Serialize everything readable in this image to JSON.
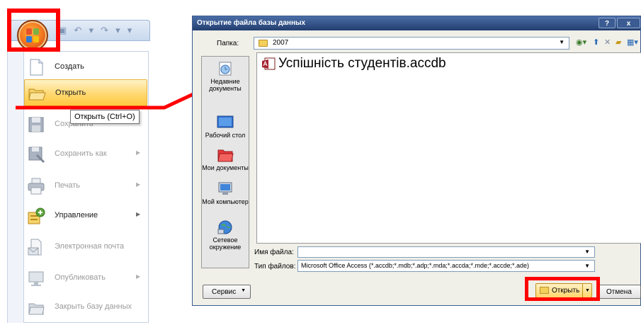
{
  "office_menu": {
    "items": [
      {
        "label": "Создать",
        "icon": "new-document-icon",
        "enabled": true,
        "submenu": false
      },
      {
        "label": "Открыть",
        "icon": "open-folder-icon",
        "enabled": true,
        "submenu": false
      },
      {
        "label": "Сохранить",
        "icon": "save-disk-icon",
        "enabled": false,
        "submenu": false
      },
      {
        "label": "Сохранить как",
        "icon": "save-as-icon",
        "enabled": false,
        "submenu": true
      },
      {
        "label": "Печать",
        "icon": "printer-icon",
        "enabled": false,
        "submenu": true
      },
      {
        "label": "Управление",
        "icon": "manage-icon",
        "enabled": true,
        "submenu": true
      },
      {
        "label": "Электронная почта",
        "icon": "email-icon",
        "enabled": false,
        "submenu": false
      },
      {
        "label": "Опубликовать",
        "icon": "publish-icon",
        "enabled": false,
        "submenu": true
      },
      {
        "label": "Закрыть базу данных",
        "icon": "close-database-icon",
        "enabled": false,
        "submenu": false
      }
    ],
    "tooltip": "Открыть (Ctrl+O)"
  },
  "dialog": {
    "title": "Открытие файла базы данных",
    "help_label": "?",
    "close_label": "x",
    "folder_label": "Папка:",
    "folder_value": "2007",
    "places": [
      {
        "label": "Недавние документы",
        "icon": "recent-documents-icon"
      },
      {
        "label": "Рабочий стол",
        "icon": "desktop-icon"
      },
      {
        "label": "Мои документы",
        "icon": "my-documents-icon"
      },
      {
        "label": "Мой компьютер",
        "icon": "my-computer-icon"
      },
      {
        "label": "Сетевое окружение",
        "icon": "network-icon"
      }
    ],
    "file_name": "Успішність студентів.accdb",
    "filename_label": "Имя файла:",
    "filename_value": "",
    "filetype_label": "Тип файлов:",
    "filetype_value": "Microsoft Office Access (*.accdb;*.mdb;*.adp;*.mda;*.accda;*.mde;*.accde;*.ade)",
    "service_label": "Сервис",
    "open_label": "Открыть",
    "cancel_label": "Отмена"
  },
  "colors": {
    "highlight_frame": "#ff0000",
    "menu_hover": "#ffd870",
    "titlebar": "#233e6f"
  }
}
